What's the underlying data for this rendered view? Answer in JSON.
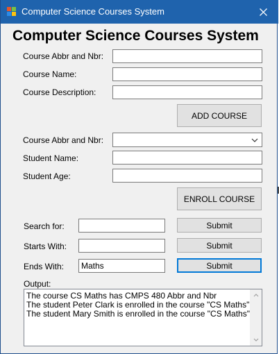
{
  "window": {
    "title": "Computer Science Courses System",
    "close_icon": "close-icon",
    "app_icon": "app-icon"
  },
  "heading": "Computer Science Courses System",
  "add_course": {
    "abbr_label": "Course Abbr and Nbr:",
    "abbr_value": "",
    "name_label": "Course Name:",
    "name_value": "",
    "description_label": "Course Description:",
    "description_value": "",
    "button_label": "ADD COURSE"
  },
  "enroll": {
    "abbr_label": "Course Abbr and Nbr:",
    "abbr_selected": "",
    "student_name_label": "Student Name:",
    "student_name_value": "",
    "student_age_label": "Student Age:",
    "student_age_value": "",
    "button_label": "ENROLL COURSE"
  },
  "search": {
    "search_for_label": "Search for:",
    "search_for_value": "",
    "starts_with_label": "Starts With:",
    "starts_with_value": "",
    "ends_with_label": "Ends With:",
    "ends_with_value": "Maths",
    "submit_label": "Submit"
  },
  "output": {
    "label": "Output:",
    "lines": [
      "The course CS Maths has CMPS 480 Abbr and Nbr",
      "The student Peter Clark is enrolled in the course \"CS Maths\"",
      "The student Mary Smith is enrolled in the course \"CS Maths\""
    ]
  },
  "colors": {
    "titlebar": "#1f63ad",
    "window_bg": "#f0f0f0",
    "focus_border": "#0078d7"
  }
}
